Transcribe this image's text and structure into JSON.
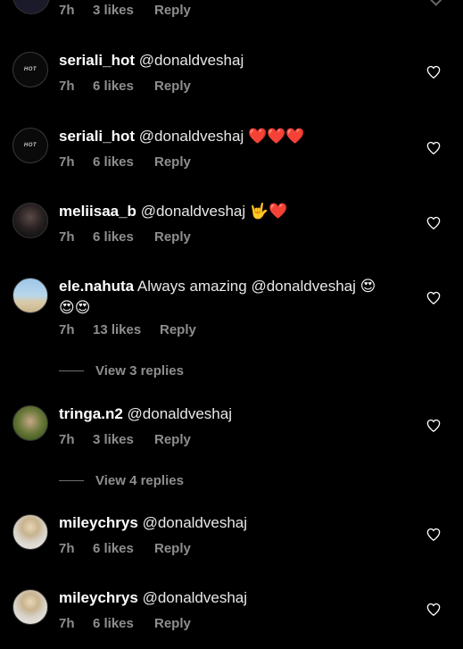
{
  "top_meta": {
    "time": "7h",
    "likes": "3 likes",
    "reply": "Reply"
  },
  "comments": [
    {
      "username": "seriali_hot",
      "text": "@donaldveshaj",
      "emojis": "",
      "time": "7h",
      "likes": "6 likes",
      "reply": "Reply",
      "avatar_icon": "hot-logo-avatar",
      "avatar_label": "HOT"
    },
    {
      "username": "seriali_hot",
      "text": "@donaldveshaj",
      "emojis": "❤️❤️❤️",
      "time": "7h",
      "likes": "6 likes",
      "reply": "Reply",
      "avatar_icon": "hot-logo-avatar",
      "avatar_label": "HOT"
    },
    {
      "username": "meliisaa_b",
      "text": "@donaldveshaj",
      "emojis": "🤟❤️",
      "time": "7h",
      "likes": "6 likes",
      "reply": "Reply",
      "avatar_icon": "profile-photo-avatar"
    },
    {
      "username": "ele.nahuta",
      "text": "Always amazing @donaldveshaj",
      "emojis_inline": "😍",
      "emojis_line2": "😍😍",
      "time": "7h",
      "likes": "13 likes",
      "reply": "Reply",
      "view_replies": "View 3 replies",
      "avatar_icon": "beach-photo-avatar"
    },
    {
      "username": "tringa.n2",
      "text": "@donaldveshaj",
      "emojis": "",
      "time": "7h",
      "likes": "3 likes",
      "reply": "Reply",
      "view_replies": "View 4 replies",
      "avatar_icon": "profile-photo-avatar"
    },
    {
      "username": "mileychrys",
      "text": "@donaldveshaj",
      "emojis": "",
      "time": "7h",
      "likes": "6 likes",
      "reply": "Reply",
      "avatar_icon": "profile-photo-avatar"
    },
    {
      "username": "mileychrys",
      "text": "@donaldveshaj",
      "emojis": "",
      "time": "7h",
      "likes": "6 likes",
      "reply": "Reply",
      "avatar_icon": "profile-photo-avatar"
    }
  ],
  "colors": {
    "background": "#000000",
    "primary_text": "#f2f2f2",
    "secondary_text": "#8e8e8e",
    "heart_outline": "#ffffff"
  }
}
